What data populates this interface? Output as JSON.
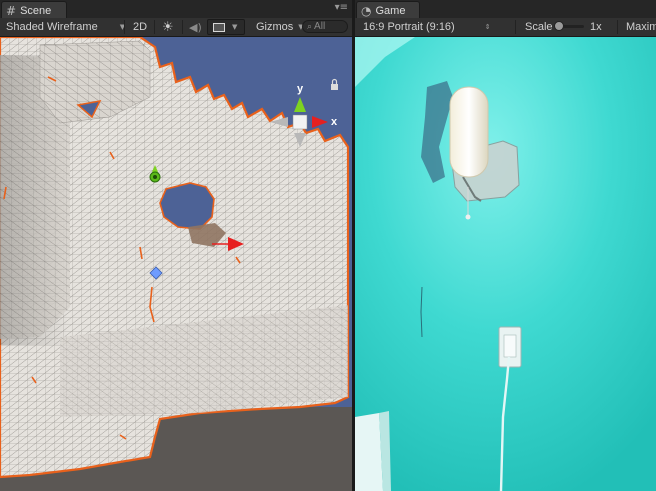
{
  "scene": {
    "tab_label": "Scene",
    "toolbar": {
      "draw_mode": "Shaded Wireframe",
      "mode_2d": "2D",
      "gizmos": "Gizmos",
      "search_placeholder": "All"
    },
    "gizmo_axes": {
      "y": "y",
      "x": "x"
    }
  },
  "game": {
    "tab_label": "Game",
    "toolbar": {
      "aspect": "16:9 Portrait (9:16)",
      "scale_label": "Scale",
      "scale_value": "1x",
      "maximize": "Maxim"
    }
  },
  "icons": {
    "scene_tab": "grid-icon",
    "game_tab": "pacman-icon",
    "lighting": "sun-icon",
    "audio": "speaker-icon",
    "effects": "image-icon",
    "pane_menu": "menu-icon",
    "lock": "lock-icon"
  },
  "colors": {
    "editor_bg": "#383838",
    "wire_edge": "#e8611c",
    "mesh_fill": "#e4e1dc",
    "sky": "#4d6296",
    "wall": "#2ed1c8",
    "gizmo_y": "#7ed321",
    "gizmo_x": "#e62020"
  }
}
